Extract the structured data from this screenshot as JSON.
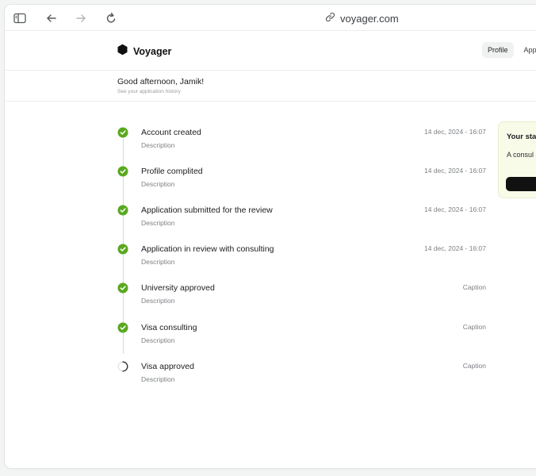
{
  "browser": {
    "url": "voyager.com"
  },
  "app": {
    "brand": "Voyager",
    "nav": [
      {
        "label": "Profile",
        "active": true
      },
      {
        "label": "App",
        "active": false
      }
    ]
  },
  "greeting": {
    "title": "Good afternoon, Jamik!",
    "subtitle": "See your application history"
  },
  "timeline": [
    {
      "title": "Account created",
      "description": "Description",
      "meta": "14 dec, 2024 - 16:07",
      "status": "done"
    },
    {
      "title": "Profile complited",
      "description": "Description",
      "meta": "14 dec, 2024 - 16:07",
      "status": "done"
    },
    {
      "title": "Application submitted for the review",
      "description": "Description",
      "meta": "14 dec, 2024 - 16:07",
      "status": "done"
    },
    {
      "title": "Application in review with consulting",
      "description": "Description",
      "meta": "14 dec, 2024 - 16:07",
      "status": "done"
    },
    {
      "title": "University approved",
      "description": "Description",
      "meta": "Caption",
      "status": "done"
    },
    {
      "title": "Visa consulting",
      "description": "Description",
      "meta": "Caption",
      "status": "done"
    },
    {
      "title": "Visa approved",
      "description": "Description",
      "meta": "Caption",
      "status": "pending"
    }
  ],
  "status_card": {
    "title": "Your sta",
    "text": "A consul and infor"
  },
  "colors": {
    "accent_green": "#5aa81f",
    "card_bg": "#f7fbe8"
  }
}
